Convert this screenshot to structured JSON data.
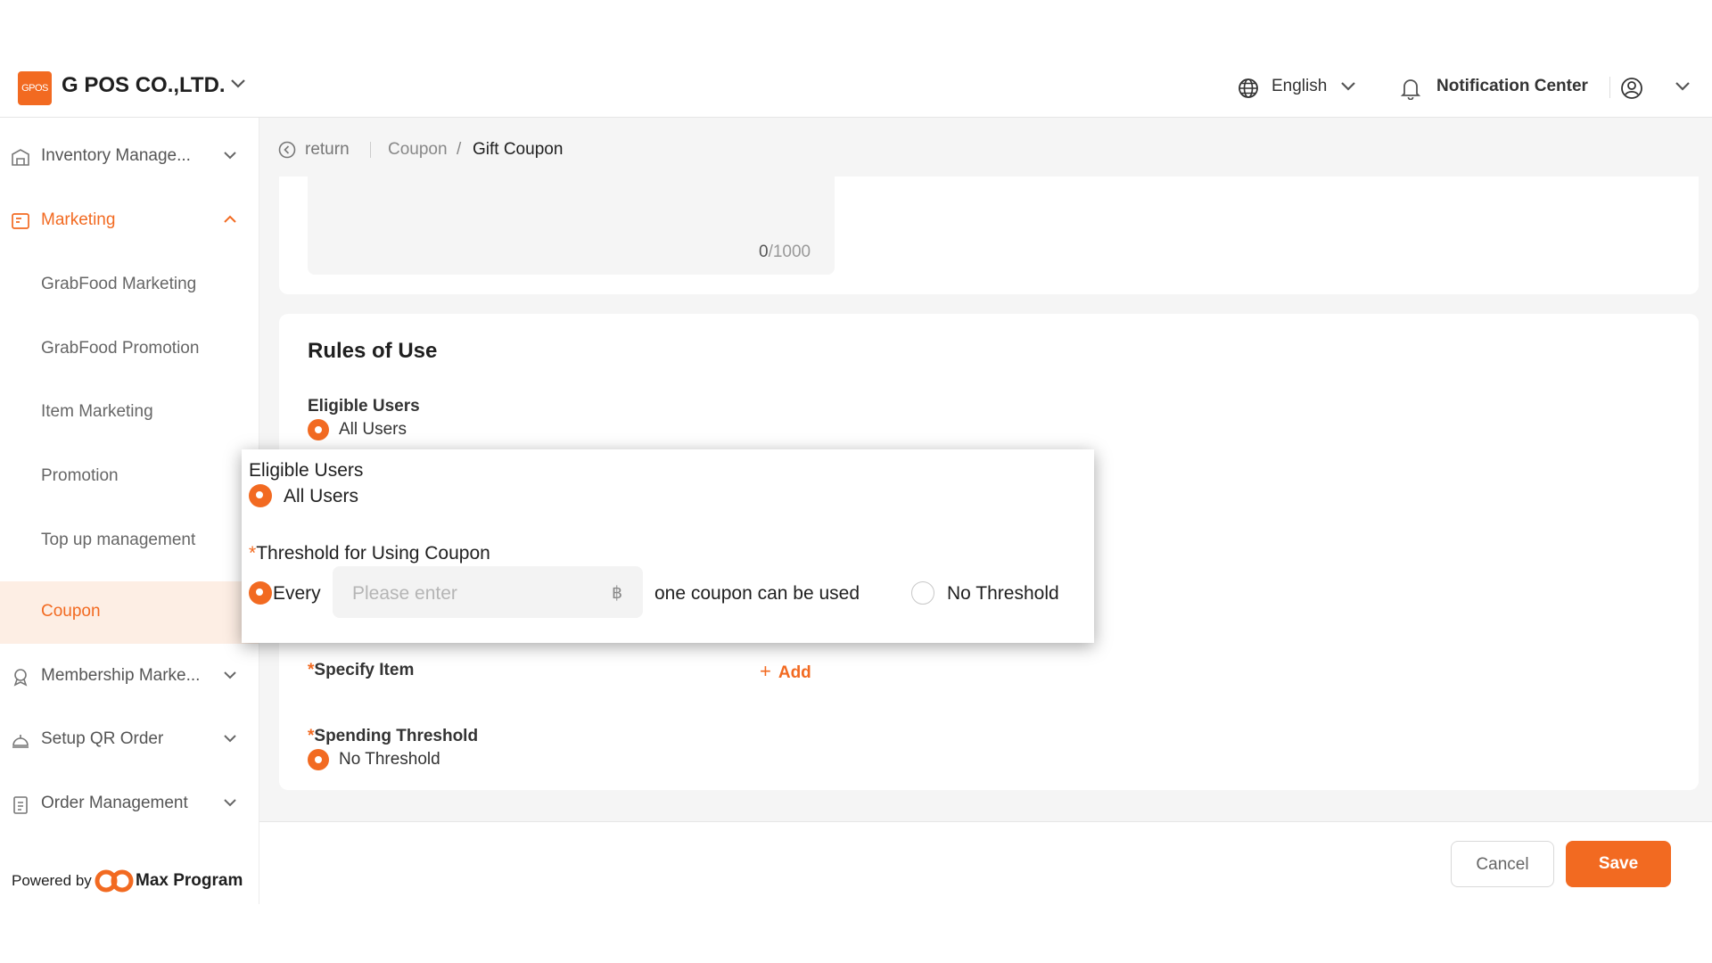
{
  "header": {
    "logo_text": "GPOS",
    "company": "G POS CO.,LTD.",
    "language": "English",
    "notification": "Notification Center"
  },
  "sidebar": {
    "items": [
      {
        "label": "Inventory Manage...",
        "icon": "warehouse-icon",
        "expandable": true
      },
      {
        "label": "Marketing",
        "icon": "marketing-icon",
        "expanded": true
      },
      {
        "label": "GrabFood Marketing"
      },
      {
        "label": "GrabFood Promotion"
      },
      {
        "label": "Item Marketing"
      },
      {
        "label": "Promotion"
      },
      {
        "label": "Top up management"
      },
      {
        "label": "Coupon",
        "active": true
      },
      {
        "label": "Membership Marke...",
        "icon": "membership-icon",
        "expandable": true
      },
      {
        "label": "Setup QR Order",
        "icon": "service-bell-icon",
        "expandable": true
      },
      {
        "label": "Order Management",
        "icon": "clipboard-icon",
        "expandable": true
      }
    ],
    "powered_by": "Powered by",
    "brand": "Max Program"
  },
  "breadcrumb": {
    "return": "return",
    "parent": "Coupon",
    "separator": "/",
    "current": "Gift Coupon"
  },
  "description": {
    "count": "0",
    "max": "/1000"
  },
  "rules": {
    "title": "Rules of Use",
    "eligible_users_label": "Eligible Users",
    "eligible_users_value": "All Users",
    "specify_item_label": "Specify Item",
    "add_label": "Add",
    "spending_threshold_label": "Spending Threshold",
    "spending_threshold_value": "No Threshold",
    "required_mark": "*"
  },
  "popup": {
    "eligible_users_label": "Eligible Users",
    "eligible_users_value": "All Users",
    "threshold_label": "Threshold for Using Coupon",
    "every_label": "Every",
    "amount_placeholder": "Please enter",
    "currency": "฿",
    "suffix": "one coupon can be used",
    "no_threshold": "No Threshold"
  },
  "footer": {
    "cancel": "Cancel",
    "save": "Save"
  },
  "colors": {
    "accent": "#f26a21",
    "active_bg": "#fdeee4",
    "page_bg": "#f5f5f5"
  }
}
